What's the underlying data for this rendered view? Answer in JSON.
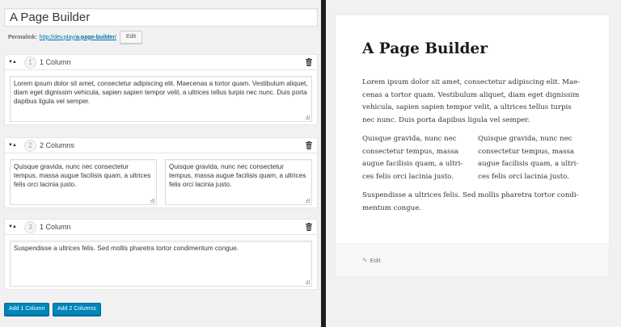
{
  "editor": {
    "title_value": "A Page Builder",
    "permalink": {
      "label": "Permalink:",
      "url_prefix": "http://dev.play/",
      "url_slug": "a-page-builder",
      "url_suffix": "/",
      "edit_label": "Edit"
    },
    "sections": [
      {
        "number": "1",
        "title": "1 Column",
        "columns": [
          "Lorem ipsum dolor sit amet, consectetur adipiscing elit. Maecenas a tortor quam. Vestibulum aliquet, diam eget dignissim vehicula, sapien sapien tempor velit, a ultrices tellus turpis nec nunc. Duis porta dapibus ligula vel semper."
        ]
      },
      {
        "number": "2",
        "title": "2 Columns",
        "columns": [
          "Quisque gravida, nunc nec consectetur tempus, massa augue facilisis quam, a ultrices felis orci lacinia justo.",
          "Quisque gravida, nunc nec consectetur tempus, massa augue facilisis quam, a ultrices felis orci lacinia justo."
        ]
      },
      {
        "number": "3",
        "title": "1 Column",
        "columns": [
          "Suspendisse a ultrices felis. Sed mollis pharetra tortor condimentum congue."
        ]
      }
    ],
    "add_1_label": "Add 1 Column",
    "add_2_label": "Add 2 Columns",
    "icons": {
      "toggle": "toggle-arrows-icon",
      "delete": "trash-icon"
    }
  },
  "preview": {
    "title": "A Page Builder",
    "paragraph_1": "Lorem ipsum dolor sit amet, consectetur adipiscing elit. Mae­cenas a tortor quam. Vestibulum aliquet, diam eget dignissim vehicula, sapien sapien tempor velit, a ultrices tellus turpis nec nunc. Duis porta dapibus ligula vel semper.",
    "col_left": "Quisque gravida, nunc nec consectetur tempus, massa augue facilisis quam, a ultri­ces felis orci lacinia justo.",
    "col_right": "Quisque gravida, nunc nec consectetur tempus, massa augue facilisis quam, a ultri­ces felis orci lacinia justo.",
    "paragraph_3": "Suspendisse a ultrices felis. Sed mollis pharetra tortor condi­mentum congue.",
    "edit_label": "Edit",
    "edit_icon": "pencil-icon"
  },
  "colors": {
    "primary_button": "#0085ba",
    "link": "#0073aa",
    "divider": "#1e1e1e"
  }
}
